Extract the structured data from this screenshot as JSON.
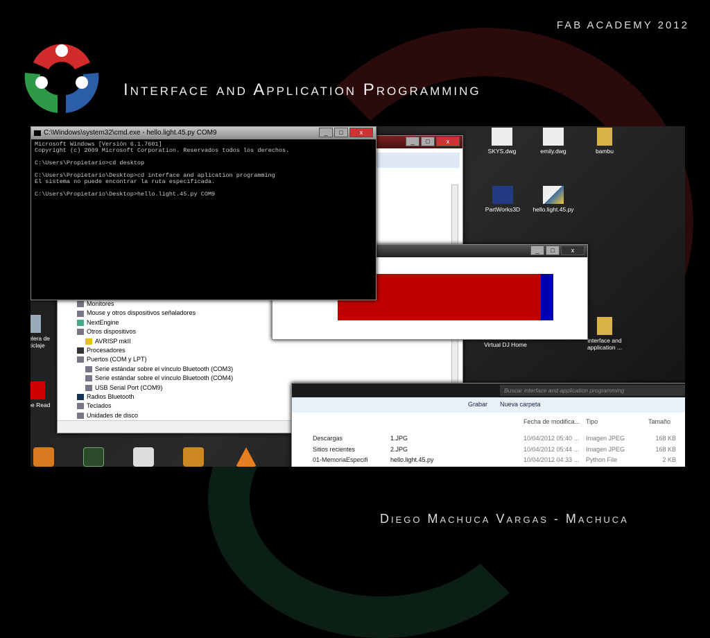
{
  "slide": {
    "header": "FAB ACADEMY 2012",
    "title": "Interface and Application Programming",
    "footer": "Diego Machuca Vargas - Machuca"
  },
  "cmd": {
    "title": "C:\\Windows\\system32\\cmd.exe - hello.light.45.py  COM9",
    "lines": [
      "Microsoft Windows [Versión 6.1.7601]",
      "Copyright (c) 2009 Microsoft Corporation. Reservados todos los derechos.",
      "",
      "C:\\Users\\Propietario>cd desktop",
      "",
      "C:\\Users\\Propietario\\Desktop>cd interface and aplication programming",
      "El sistema no puede encontrar la ruta especificada.",
      "",
      "C:\\Users\\Propietario\\Desktop>hello.light.45.py COM9"
    ]
  },
  "device_manager": {
    "items": [
      "Monitores",
      "Mouse y otros dispositivos señaladores",
      "NextEngine",
      "Otros dispositivos",
      "AVRISP mkII",
      "Procesadores",
      "Puertos (COM y LPT)",
      "Serie estándar sobre el vínculo Bluetooth (COM3)",
      "Serie estándar sobre el vínculo Bluetooth (COM4)",
      "USB Serial Port (COM9)",
      "Radios Bluetooth",
      "Teclados",
      "Unidades de disco"
    ]
  },
  "hello_light": {
    "level_fraction": 0.94,
    "colors": {
      "bar": "#c00000",
      "marker": "#0000b0"
    }
  },
  "desktop": {
    "icons": [
      "SKYS.dwg",
      "emily.dwg",
      "bambu",
      "PartWorks3D",
      "hello.light.45.py",
      "Virtual DJ Home",
      "interface and application ...",
      "Papelera de reciclaje",
      "obe Read"
    ]
  },
  "explorer": {
    "search_placeholder": "Buscar interface and application programming",
    "toolbar": [
      "Grabar",
      "Nueva carpeta"
    ],
    "columns": [
      "Fecha de modifica...",
      "Tipo",
      "Tamaño"
    ],
    "nav": [
      "Descargas",
      "Sitios recientes",
      "01-MemoriaEspecifi"
    ],
    "files": [
      {
        "name": "1.JPG",
        "date": "10/04/2012 05:40 ...",
        "type": "Imagen JPEG",
        "size": "168 KB"
      },
      {
        "name": "2.JPG",
        "date": "10/04/2012 05:44 ...",
        "type": "Imagen JPEG",
        "size": "168 KB"
      },
      {
        "name": "hello.light.45.py",
        "date": "10/04/2012 04:33 ...",
        "type": "Python File",
        "size": "2 KB"
      }
    ]
  }
}
